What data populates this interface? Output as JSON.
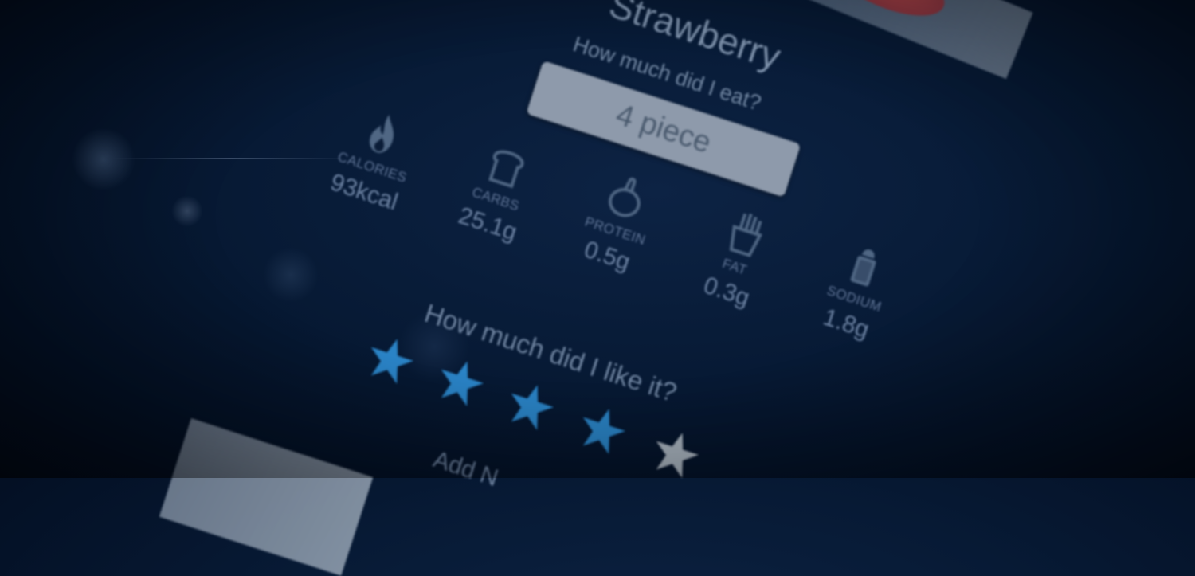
{
  "food": {
    "name": "Strawberry"
  },
  "portion": {
    "question": "How much did I eat?",
    "value": "4 piece"
  },
  "nutrients": [
    {
      "label": "CALORIES",
      "value": "93kcal",
      "icon": "flame-icon"
    },
    {
      "label": "CARBS",
      "value": "25.1g",
      "icon": "bread-icon"
    },
    {
      "label": "PROTEIN",
      "value": "0.5g",
      "icon": "drumstick-icon"
    },
    {
      "label": "FAT",
      "value": "0.3g",
      "icon": "fries-icon"
    },
    {
      "label": "SODIUM",
      "value": "1.8g",
      "icon": "salt-shaker-icon"
    }
  ],
  "rating": {
    "question": "How much did I like it?",
    "value": 4,
    "max": 5,
    "filled_color": "#2f8fd6",
    "empty_color": "#c9d2dc"
  },
  "note": {
    "label": "Add N"
  }
}
